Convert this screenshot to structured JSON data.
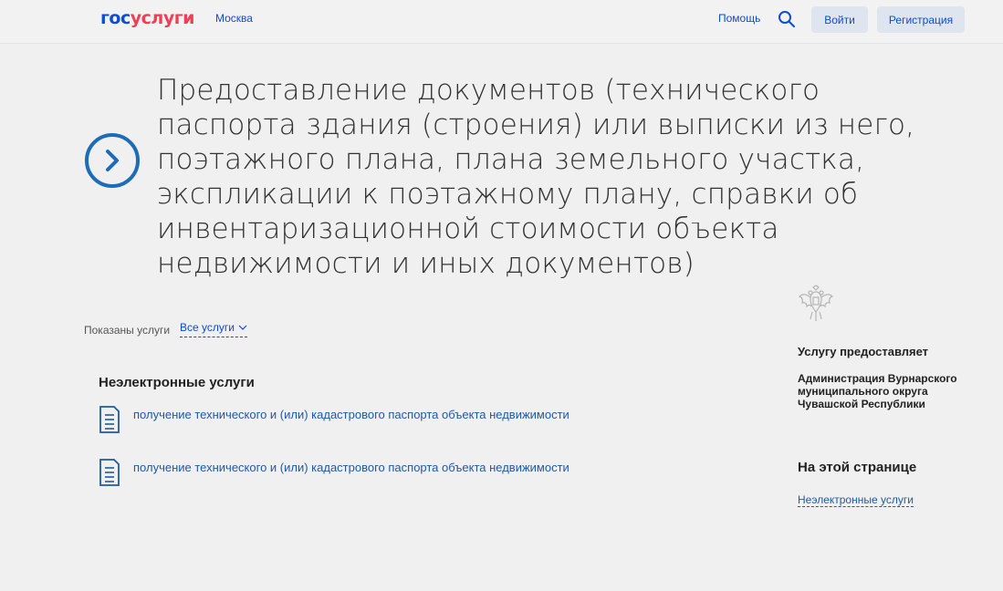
{
  "header": {
    "logo_part1": "гос",
    "logo_part2": "услуги",
    "city": "Москва",
    "help_label": "Помощь",
    "login_label": "Войти",
    "register_label": "Регистрация"
  },
  "main": {
    "title": "Предоставление документов (технического паспорта здания (строения) или выписки из него, поэтажного плана, плана земельного участка, экспликации к поэтажному плану, справки об инвентаризационной стоимости объекта недвижимости и иных документов)"
  },
  "filter": {
    "label": "Показаны услуги",
    "selected": "Все услуги"
  },
  "services_section": {
    "title": "Неэлектронные услуги",
    "items": [
      {
        "label": "получение технического и (или) кадастрового паспорта объекта недвижимости"
      },
      {
        "label": "получение технического и (или) кадастрового паспорта объекта недвижимости"
      }
    ]
  },
  "sidebar": {
    "provider_label": "Услугу предоставляет",
    "provider_name": "Администрация Вурнарского муниципального округа Чувашской Республики",
    "on_page_title": "На этой странице",
    "on_page_links": [
      {
        "label": "Неэлектронные услуги"
      }
    ]
  },
  "colors": {
    "brand_blue": "#0d4cd3",
    "brand_red": "#ee3f58",
    "link_blue": "#1e5aa6",
    "background": "#f0f0f0"
  },
  "icons": [
    "search-icon",
    "chevron-right-circle-icon",
    "chevron-down-icon",
    "document-icon",
    "coat-of-arms-icon"
  ]
}
